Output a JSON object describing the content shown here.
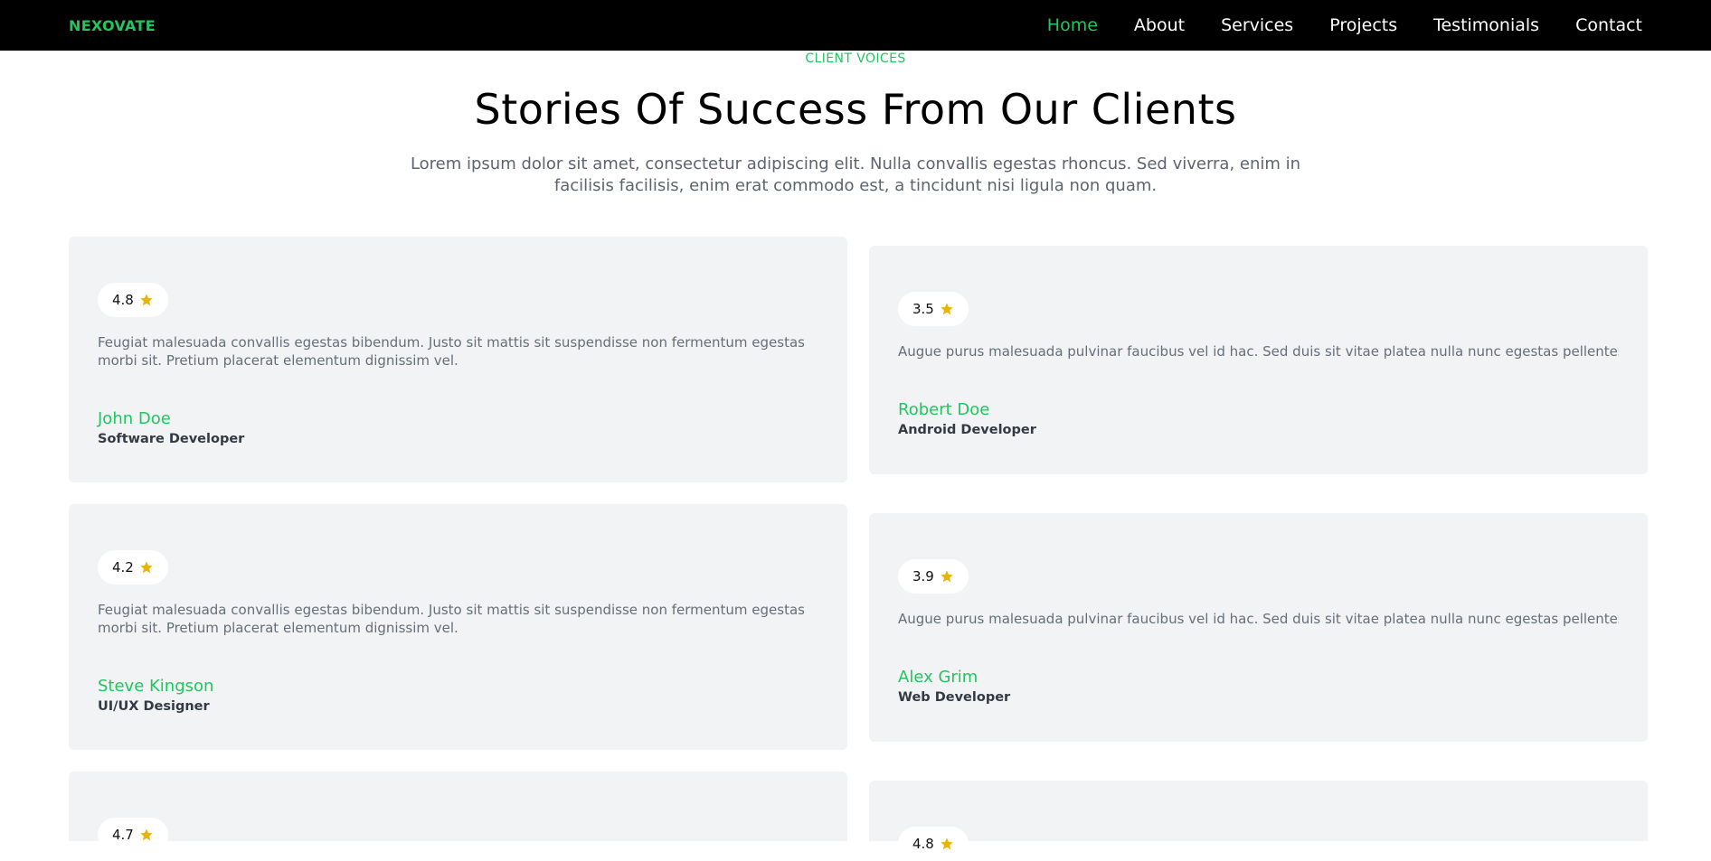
{
  "nav": {
    "brand": "NEXOVATE",
    "links": [
      "Home",
      "About",
      "Services",
      "Projects",
      "Testimonials",
      "Contact"
    ],
    "active": "Home"
  },
  "section": {
    "eyebrow": "CLIENT VOICES",
    "title": "Stories Of Success From Our Clients",
    "intro": "Lorem ipsum dolor sit amet, consectetur adipiscing elit. Nulla convallis egestas rhoncus. Sed viverra, enim in facilisis facilisis, enim erat commodo est, a tincidunt nisi ligula non quam."
  },
  "testimonials": [
    {
      "rating": "4.8",
      "quote": "Feugiat malesuada convallis egestas bibendum. Justo sit mattis sit suspendisse non fermentum egestas morbi sit. Pretium placerat elementum dignissim vel.",
      "name": "John Doe",
      "role": "Software Developer"
    },
    {
      "rating": "3.5",
      "quote": "Augue purus malesuada pulvinar faucibus vel id hac. Sed duis sit vitae platea nulla nunc egestas pellentesque et",
      "name": "Robert Doe",
      "role": "Android Developer"
    },
    {
      "rating": "4.2",
      "quote": "Feugiat malesuada convallis egestas bibendum. Justo sit mattis sit suspendisse non fermentum egestas morbi sit. Pretium placerat elementum dignissim vel.",
      "name": "Steve Kingson",
      "role": "UI/UX Designer"
    },
    {
      "rating": "3.9",
      "quote": "Augue purus malesuada pulvinar faucibus vel id hac. Sed duis sit vitae platea nulla nunc egestas pellentesque et",
      "name": "Alex Grim",
      "role": "Web Developer"
    },
    {
      "rating": "4.7"
    },
    {
      "rating": "4.8"
    }
  ],
  "colors": {
    "accent": "#22c55e",
    "star": "#eab308",
    "card": "#f2f3f5"
  }
}
